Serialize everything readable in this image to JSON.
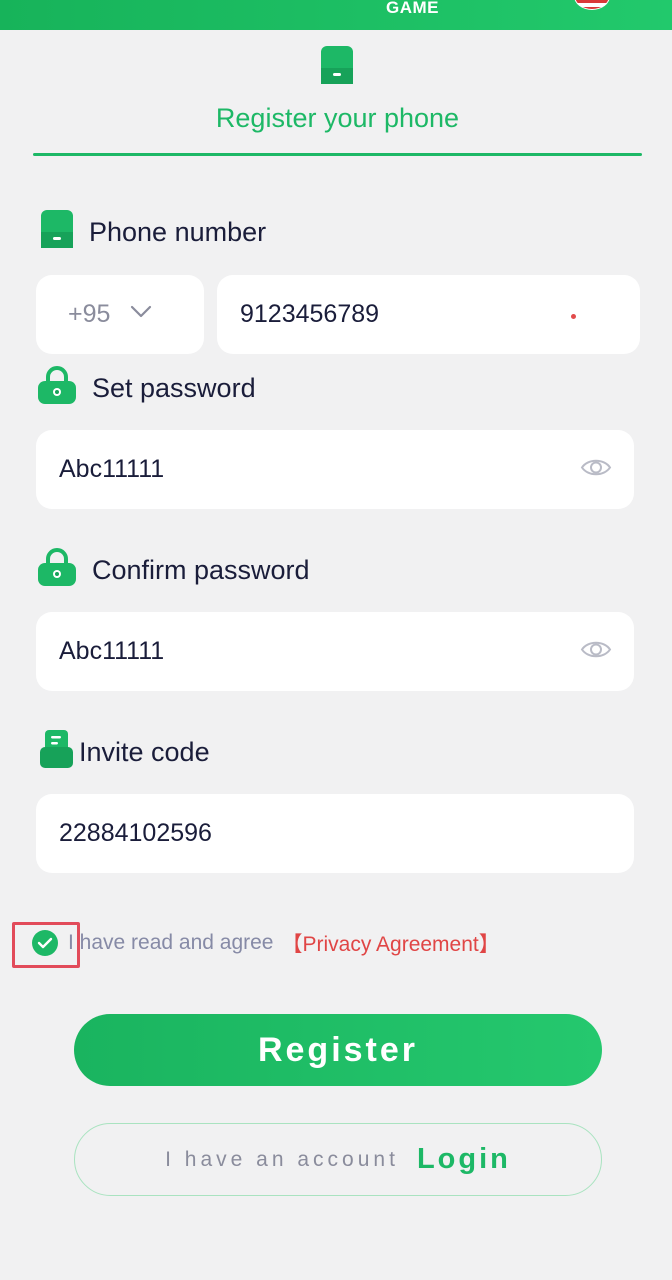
{
  "header": {
    "brand": "GAME"
  },
  "tabs": [
    {
      "label": "Register your phone",
      "active": true
    }
  ],
  "phone": {
    "label": "Phone number",
    "country_code": "+95",
    "value": "9123456789"
  },
  "password": {
    "label": "Set password",
    "value": "Abc11111"
  },
  "confirm_password": {
    "label": "Confirm password",
    "value": "Abc11111"
  },
  "invite": {
    "label": "Invite code",
    "value": "22884102596"
  },
  "agreement": {
    "checked": true,
    "text": "I have read and agree",
    "link": "【Privacy Agreement】"
  },
  "actions": {
    "register": "Register",
    "have_account": "I have an account",
    "login": "Login"
  },
  "colors": {
    "accent": "#1db866",
    "background": "#f1f1f2",
    "link_red": "#e04545",
    "highlight_red": "#e24b5a"
  },
  "icons": {
    "tab": "phone-icon",
    "phone": "phone-icon",
    "password": "lock-icon",
    "confirm": "lock-icon",
    "invite": "invite-code-icon",
    "visibility": "eye-icon",
    "dropdown": "chevron-down-icon",
    "checkbox": "check-icon"
  }
}
